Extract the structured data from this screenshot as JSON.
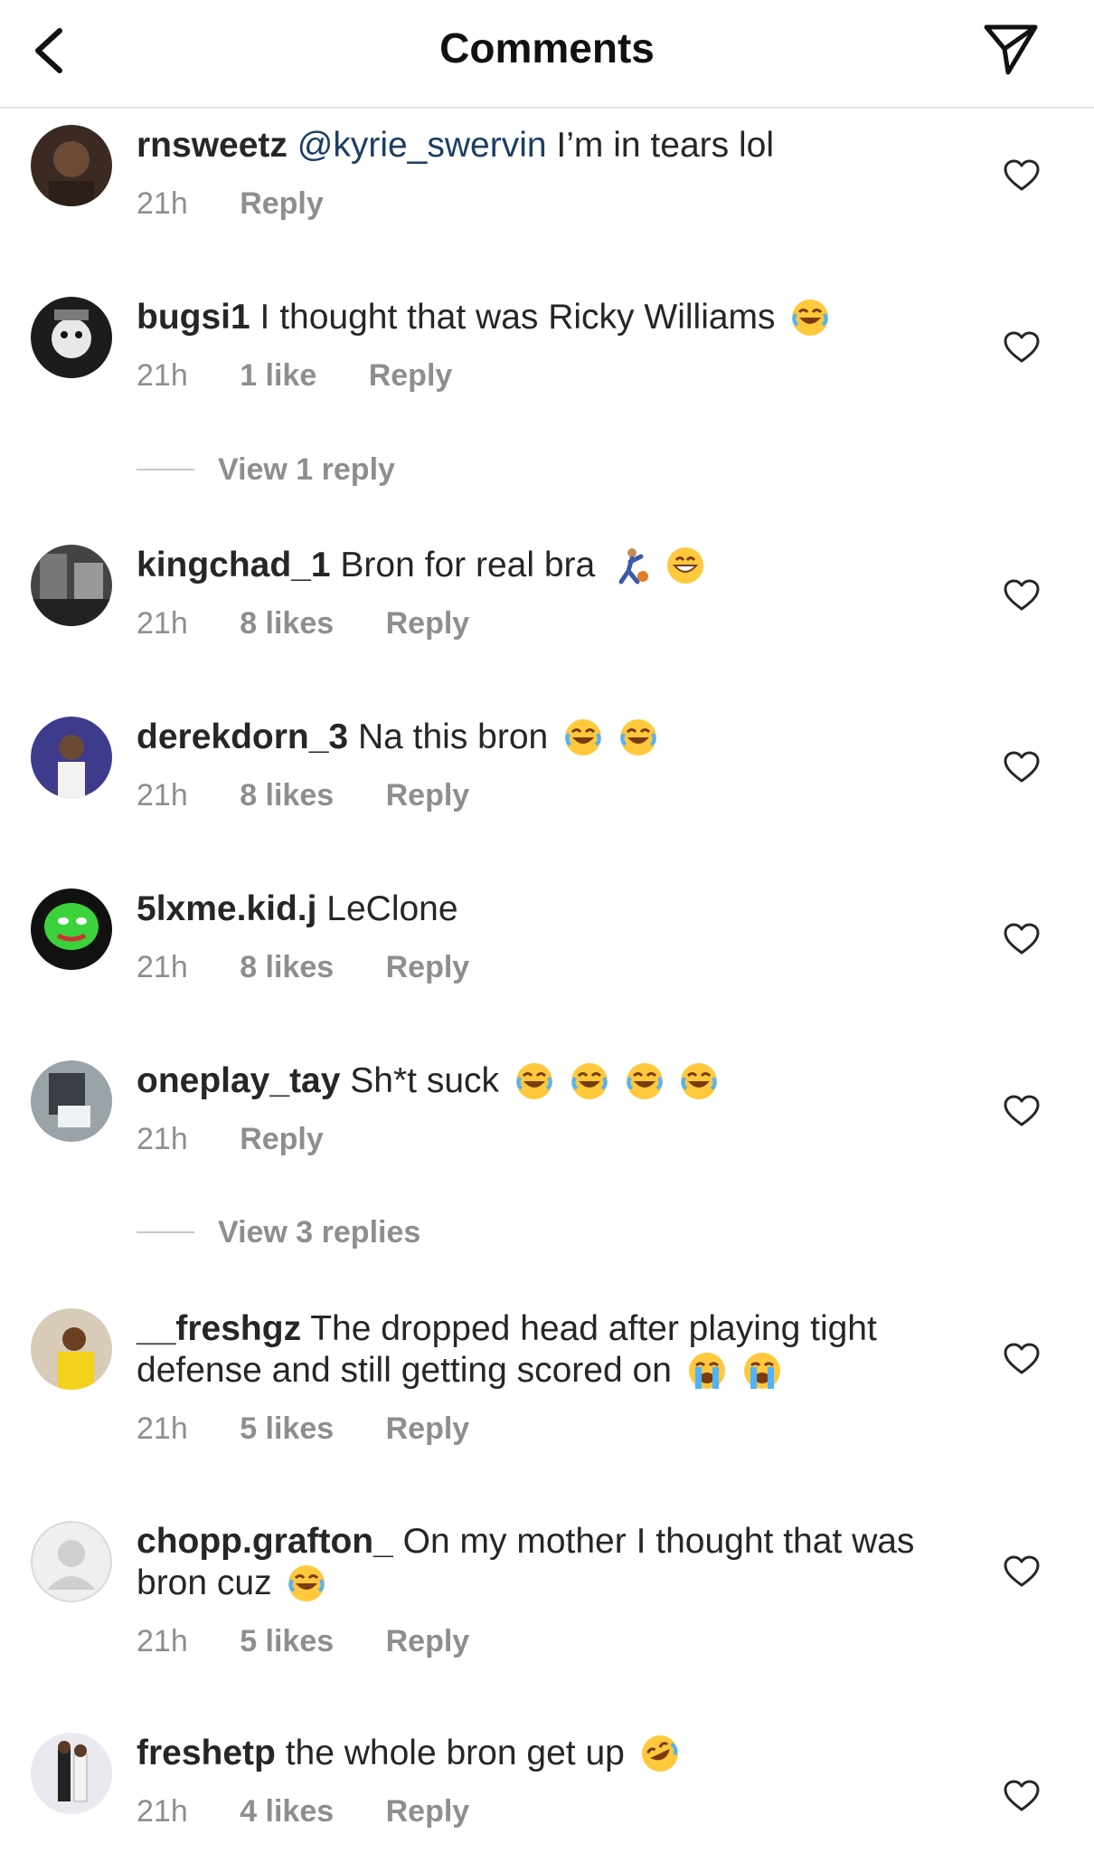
{
  "header": {
    "title": "Comments",
    "back_icon": "chevron-left-icon",
    "share_icon": "send-icon"
  },
  "comments": [
    {
      "username": "rnsweetz",
      "mention": "@kyrie_swervin",
      "text": " I’m in tears lol",
      "time": "21h",
      "likes": "",
      "reply": "Reply"
    },
    {
      "username": "bugsi1",
      "text": " I thought that was Ricky Williams",
      "time": "21h",
      "likes": "1 like",
      "reply": "Reply",
      "emojis": [
        "face-with-tears-of-joy"
      ]
    },
    {
      "username": "kingchad_1",
      "text": " Bron for real bra",
      "time": "21h",
      "likes": "8 likes",
      "reply": "Reply",
      "emojis": [
        "person-bouncing-ball",
        "grinning-face"
      ]
    },
    {
      "username": "derekdorn_3",
      "text": " Na this bron",
      "time": "21h",
      "likes": "8 likes",
      "reply": "Reply",
      "emojis": [
        "face-with-tears-of-joy",
        "face-with-tears-of-joy"
      ]
    },
    {
      "username": "5lxme.kid.j",
      "text": " LeClone",
      "time": "21h",
      "likes": "8 likes",
      "reply": "Reply"
    },
    {
      "username": "oneplay_tay",
      "text": " Sh*t suck",
      "time": "21h",
      "likes": "",
      "reply": "Reply",
      "emojis": [
        "face-with-tears-of-joy",
        "face-with-tears-of-joy",
        "face-with-tears-of-joy",
        "face-with-tears-of-joy"
      ]
    },
    {
      "username": "__freshgz",
      "text": " The dropped head after playing tight defense and still getting scored on",
      "time": "21h",
      "likes": "5 likes",
      "reply": "Reply",
      "emojis": [
        "loudly-crying-face",
        "loudly-crying-face"
      ]
    },
    {
      "username": "chopp.grafton_",
      "text": " On my mother I thought that was bron cuz",
      "time": "21h",
      "likes": "5 likes",
      "reply": "Reply",
      "emojis": [
        "face-with-tears-of-joy"
      ]
    },
    {
      "username": "freshetp",
      "text": " the whole bron get up",
      "time": "21h",
      "likes": "4 likes",
      "reply": "Reply",
      "emojis": [
        "rolling-on-the-floor-laughing"
      ]
    }
  ],
  "view_replies": [
    {
      "label": "View 1 reply"
    },
    {
      "label": "View 3 replies"
    }
  ],
  "colors": {
    "text": "#262626",
    "secondary": "#8e8e8e",
    "mention": "#1c3e63",
    "divider": "#e6e6e6"
  }
}
